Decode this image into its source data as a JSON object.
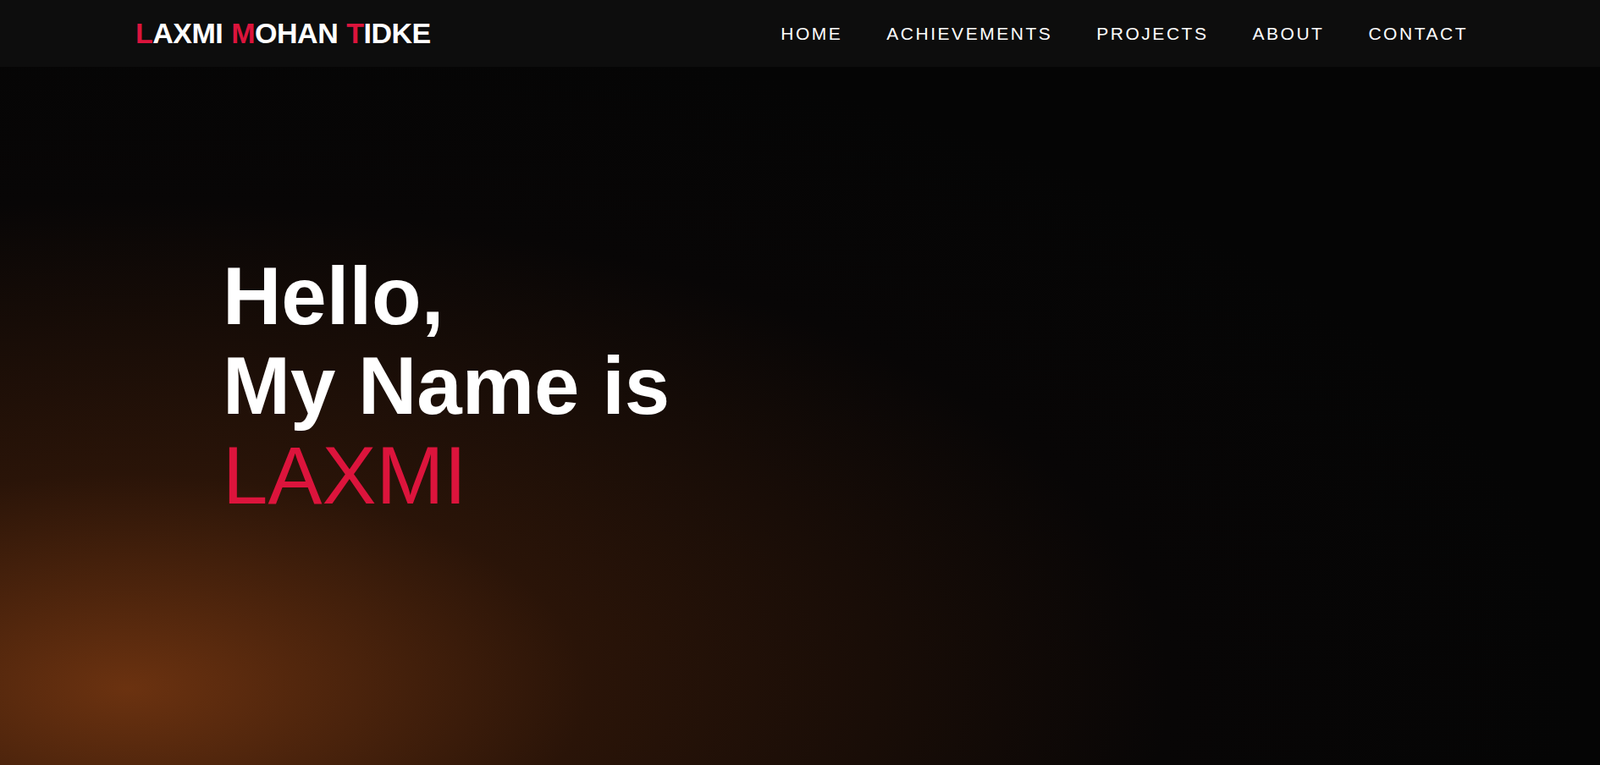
{
  "nav": {
    "logo": [
      {
        "parts": [
          {
            "text": "L",
            "accent": true
          },
          {
            "text": "AXMI",
            "accent": false
          }
        ]
      },
      {
        "parts": [
          {
            "text": "M",
            "accent": true
          },
          {
            "text": "OHAN",
            "accent": false
          }
        ]
      },
      {
        "parts": [
          {
            "text": "T",
            "accent": true
          },
          {
            "text": "IDKE",
            "accent": false
          }
        ]
      }
    ],
    "links": [
      "HOME",
      "ACHIEVEMENTS",
      "PROJECTS",
      "ABOUT",
      "CONTACT"
    ]
  },
  "hero": {
    "lines": [
      "Hello,",
      "My Name is"
    ],
    "name": "LAXMI"
  }
}
